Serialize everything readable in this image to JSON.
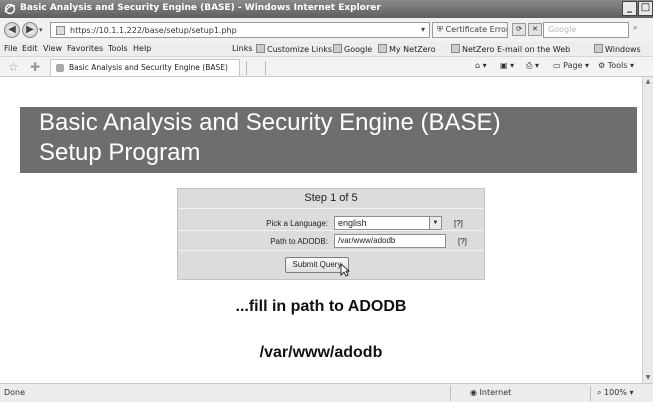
{
  "window": {
    "title": "Basic Analysis and Security Engine (BASE) - Windows Internet Explorer",
    "minimize": "_",
    "maximize": "□"
  },
  "address": {
    "url": "https://10.1.1.222/base/setup/setup1.php",
    "cert_error": "Certificate Error",
    "search_placeholder": "Google"
  },
  "menu": [
    "File",
    "Edit",
    "View",
    "Favorites",
    "Tools",
    "Help"
  ],
  "links": {
    "label": "Links",
    "items": [
      "Customize Links",
      "Google",
      "My NetZero",
      "NetZero E-mail on the Web",
      "Windows"
    ]
  },
  "tab": {
    "label": "Basic Analysis and Security Engine (BASE)"
  },
  "commands": {
    "page": "Page",
    "tools": "Tools"
  },
  "banner": {
    "line1": "Basic Analysis and Security Engine (BASE)",
    "line2": "Setup Program"
  },
  "form": {
    "step": "Step 1 of 5",
    "language_label": "Pick a Language:",
    "language_value": "english",
    "adodb_label": "Path to ADODB:",
    "adodb_value": "/var/www/adodb",
    "help": "[?]",
    "submit": "Submit Query"
  },
  "notes": {
    "line1": "...fill in path to ADODB",
    "line2": "/var/www/adodb"
  },
  "status": {
    "text": "Done",
    "zone": "Internet",
    "zoom": "100%"
  },
  "colors": {
    "banner_bg": "#6e6e6e",
    "form_bg": "#dcdcdc",
    "titlebar": "#6a6a6a"
  }
}
